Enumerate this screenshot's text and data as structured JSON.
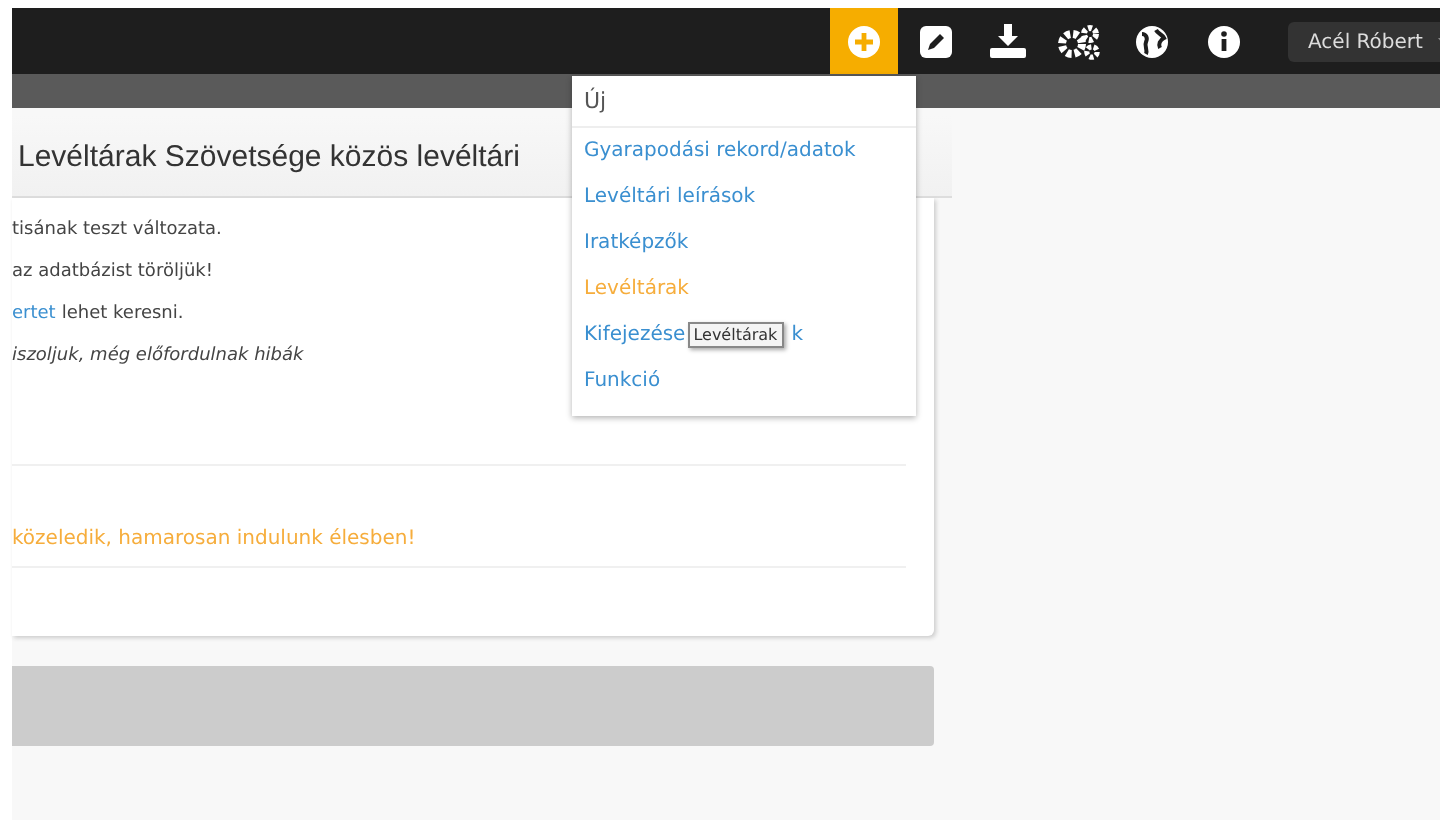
{
  "navbar": {
    "icons": [
      {
        "kind": "plus",
        "selected": true
      },
      {
        "kind": "pencil",
        "selected": false
      },
      {
        "kind": "download",
        "selected": false
      },
      {
        "kind": "gears",
        "selected": false
      },
      {
        "kind": "globe",
        "selected": false
      },
      {
        "kind": "info",
        "selected": false
      }
    ],
    "user": "Acél Róbert"
  },
  "page": {
    "title": "Levéltárak Szövetsége közös levéltári"
  },
  "card": {
    "lines": [
      {
        "kind": "plain",
        "text": "tisának teszt változata."
      },
      {
        "kind": "plain",
        "text": "az adatbázist töröljük!"
      },
      {
        "kind": "link",
        "link": "ertet",
        "text": "lehet keresni."
      },
      {
        "kind": "italic",
        "text": "iszoljuk, még előfordulnak hibák"
      }
    ],
    "notice": "közeledik, hamarosan indulunk élesben!"
  },
  "dropdown": {
    "header": "Új",
    "items": [
      {
        "label": "Gyarapodási rekord/adatok",
        "selected": false
      },
      {
        "label": "Levéltári leírások",
        "selected": false
      },
      {
        "label": "Iratképzők",
        "selected": false
      },
      {
        "label": "Levéltárak",
        "selected": true
      },
      {
        "label": "Kifejezése",
        "tail": "k",
        "selected": false
      },
      {
        "label": "Funkció",
        "selected": false
      }
    ]
  },
  "tooltip": "Levéltárak"
}
